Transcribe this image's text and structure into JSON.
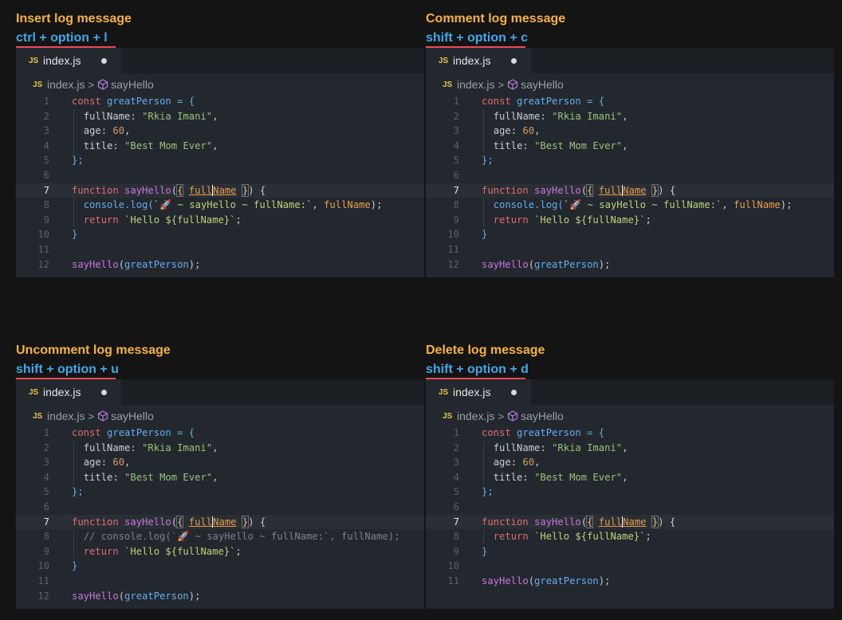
{
  "panels": [
    {
      "title": "Insert log message",
      "shortcut": "ctrl + option + l"
    },
    {
      "title": "Comment log message",
      "shortcut": "shift + option + c"
    },
    {
      "title": "Uncomment log message",
      "shortcut": "shift + option + u"
    },
    {
      "title": "Delete log message",
      "shortcut": "shift + option + d"
    }
  ],
  "editor": {
    "file_badge": "JS",
    "file_name": "index.js",
    "breadcrumb_file": "index.js",
    "breadcrumb_sep": ">",
    "breadcrumb_symbol": "sayHello"
  },
  "code": {
    "decl_kw": "const",
    "obj_name": "greatPerson",
    "eq": " = {",
    "k1": "fullName: ",
    "v1": "\"Rkia Imani\"",
    "k2": "age: ",
    "v2": "60",
    "k3": "title: ",
    "v3": "\"Best Mom Ever\"",
    "close_obj": "};",
    "fn_kw": "function",
    "fn_name": "sayHello",
    "param": "fullName",
    "log_prefix": "console.log(",
    "log_string": "`🚀 ~ sayHello ~ fullName:`",
    "log_arg": "fullName",
    "log_comment": "// console.log(`🚀 ~ sayHello ~ fullName:`, fullName);",
    "ret_kw": "return",
    "ret_str": "`Hello ${fullName}`",
    "close_fn": "}",
    "call_fn": "sayHello",
    "call_arg": "greatPerson",
    "line_numbers_12": [
      "1",
      "2",
      "3",
      "4",
      "5",
      "6",
      "7",
      "8",
      "9",
      "10",
      "11",
      "12"
    ],
    "line_numbers_11": [
      "1",
      "2",
      "3",
      "4",
      "5",
      "6",
      "7",
      "8",
      "9",
      "10",
      "11"
    ]
  },
  "colors": {
    "title": "#f5b23f",
    "shortcut": "#3ea8e6",
    "underline": "#ef4b58",
    "editor_bg": "#23272e"
  }
}
